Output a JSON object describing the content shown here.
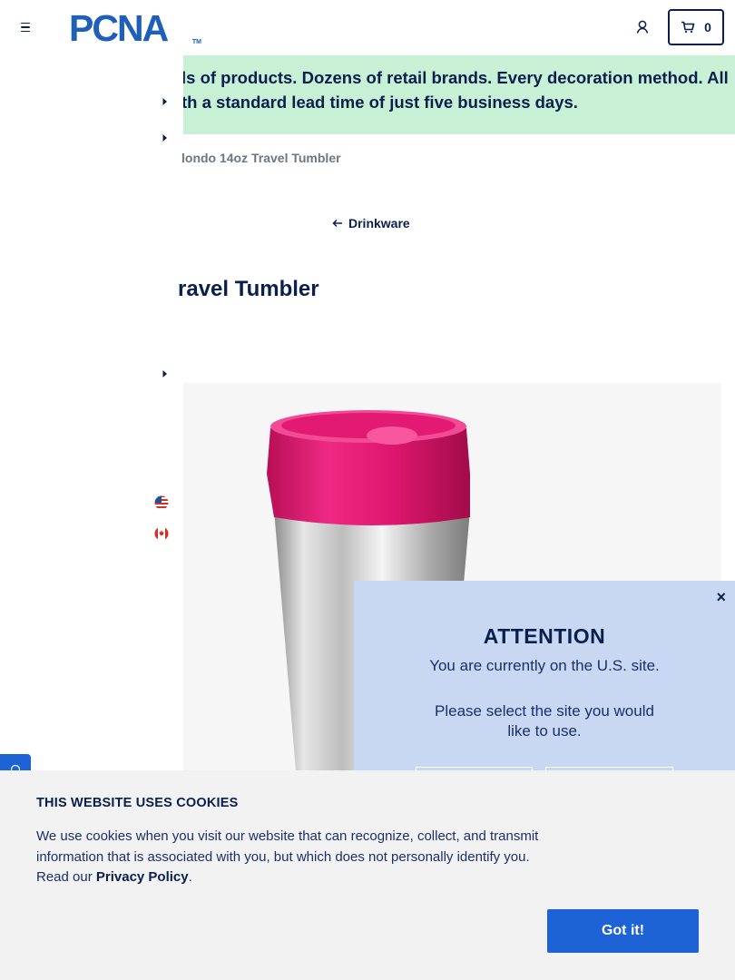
{
  "header": {
    "logo_text": "PCNA",
    "logo_tm": "TM",
    "cart_count": "0"
  },
  "banner": {
    "line1": "ls of products. Dozens of retail brands. Every decoration method. All",
    "line2": "th a standard lead time of just five business days."
  },
  "breadcrumb": "londo 14oz Travel Tumbler",
  "back_link": "Drinkware",
  "product": {
    "title": "ravel Tumbler",
    "body_color": "#c9c9c9",
    "lid_color": "#e0176f"
  },
  "attention": {
    "close": "×",
    "title": "ATTENTION",
    "subtitle": "You are currently on the U.S. site.",
    "question": "Please select the site you would like to use."
  },
  "cookie": {
    "title": "THIS WEBSITE USES COOKIES",
    "body": "We use cookies when you visit our website that can recognize, collect, and transmit information that is associated with you, but which does not personally identify you. Read our ",
    "link": "Privacy Policy",
    "after": ".",
    "button": "Got it!"
  },
  "colors": {
    "navy": "#0a1f4e",
    "brand_blue": "#1e5fb8",
    "button_blue": "#1e63d6",
    "banner_green": "#c8f0d4",
    "modal_blue": "#c9d8f2"
  }
}
